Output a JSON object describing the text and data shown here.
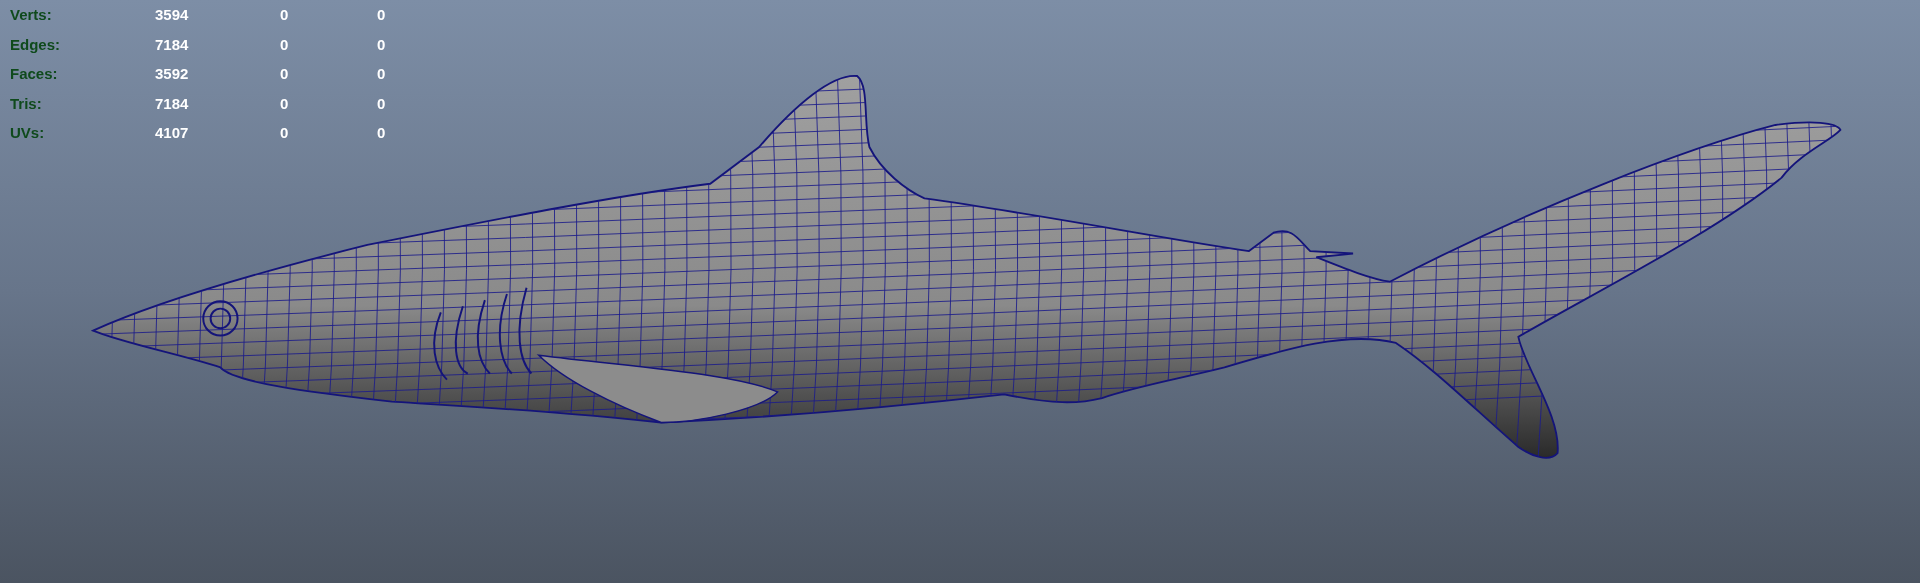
{
  "hud": {
    "rows": [
      {
        "label": "Verts:",
        "values": [
          "3594",
          "0",
          "0"
        ]
      },
      {
        "label": "Edges:",
        "values": [
          "7184",
          "0",
          "0"
        ]
      },
      {
        "label": "Faces:",
        "values": [
          "3592",
          "0",
          "0"
        ]
      },
      {
        "label": "Tris:",
        "values": [
          "7184",
          "0",
          "0"
        ]
      },
      {
        "label": "UVs:",
        "values": [
          "4107",
          "0",
          "0"
        ]
      }
    ]
  }
}
